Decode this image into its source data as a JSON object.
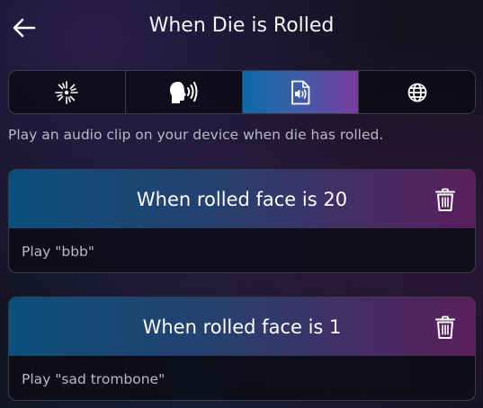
{
  "header": {
    "title": "When Die is Rolled",
    "back_icon": "arrow-left-icon"
  },
  "tabs": [
    {
      "icon": "sparkle-icon",
      "active": false
    },
    {
      "icon": "speaking-head-icon",
      "active": false
    },
    {
      "icon": "audio-file-icon",
      "active": true
    },
    {
      "icon": "globe-icon",
      "active": false
    }
  ],
  "description": "Play an audio clip on your device when die has rolled.",
  "rules": [
    {
      "title": "When rolled face is 20",
      "action": "Play \"bbb\"",
      "delete_icon": "trash-icon"
    },
    {
      "title": "When rolled face is 1",
      "action": "Play \"sad trombone\"",
      "delete_icon": "trash-icon"
    }
  ],
  "colors": {
    "active_tab_start": "#0b6aa8",
    "active_tab_end": "#7a3aa0",
    "card_head_start": "#0c4f7c",
    "card_head_end": "#5a1f5c"
  }
}
